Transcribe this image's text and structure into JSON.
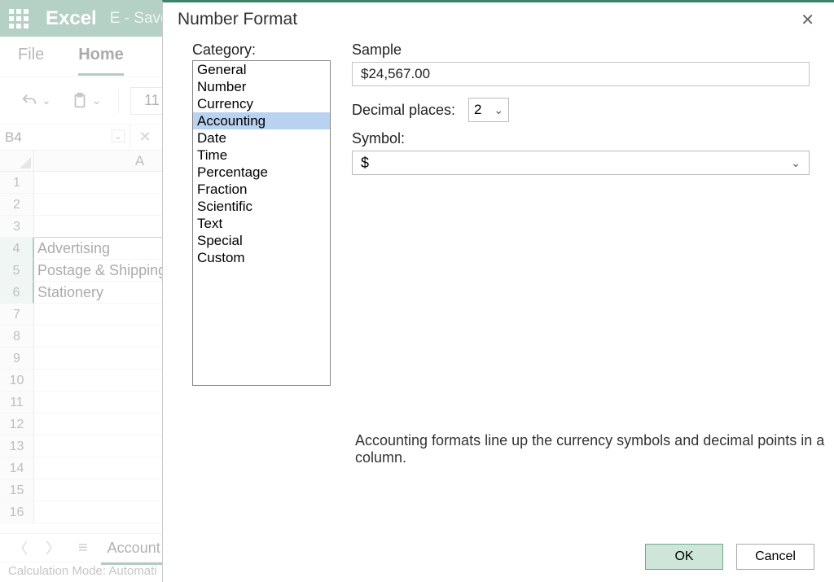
{
  "titlebar": {
    "app": "Excel",
    "doc": "E - Save"
  },
  "ribbon": {
    "tabs": [
      "File",
      "Home"
    ],
    "active": 1
  },
  "toolbar": {
    "font_size": "11"
  },
  "namebox": {
    "ref": "B4"
  },
  "grid": {
    "col_headers": [
      "A"
    ],
    "row_headers": [
      "1",
      "2",
      "3",
      "4",
      "5",
      "6",
      "7",
      "8",
      "9",
      "10",
      "11",
      "12",
      "13",
      "14",
      "15",
      "16"
    ],
    "selected_rows": [
      4,
      5,
      6
    ],
    "cells": {
      "A4": "Advertising",
      "A5": "Postage & Shipping",
      "A6": "Stationery"
    }
  },
  "sheet_tabs": {
    "active": "Account"
  },
  "status": {
    "text": "Calculation Mode: Automati"
  },
  "dialog": {
    "title": "Number Format",
    "category_label": "Category:",
    "categories": [
      "General",
      "Number",
      "Currency",
      "Accounting",
      "Date",
      "Time",
      "Percentage",
      "Fraction",
      "Scientific",
      "Text",
      "Special",
      "Custom"
    ],
    "selected_category": "Accounting",
    "sample_label": "Sample",
    "sample_value": "$24,567.00",
    "decimal_label": "Decimal places:",
    "decimal_value": "2",
    "symbol_label": "Symbol:",
    "symbol_value": "$",
    "description": "Accounting formats line up the currency symbols and decimal points in a column.",
    "ok": "OK",
    "cancel": "Cancel"
  }
}
